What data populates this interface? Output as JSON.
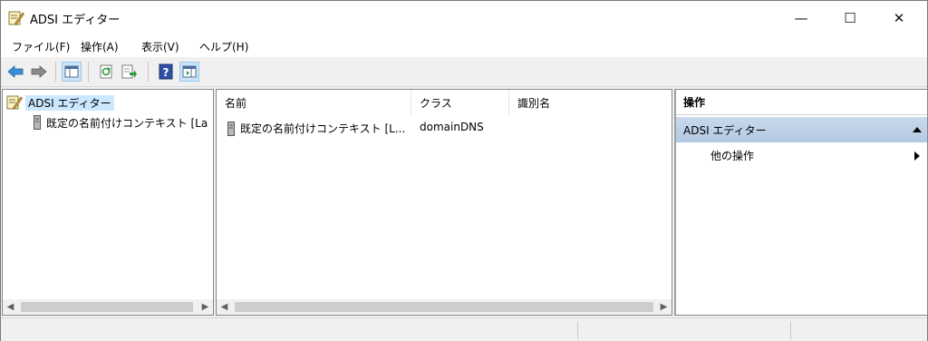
{
  "window": {
    "title": "ADSI エディター",
    "min_glyph": "—",
    "max_glyph": "☐",
    "close_glyph": "✕"
  },
  "menu": [
    {
      "label": "ファイル(F)"
    },
    {
      "label": "操作(A)"
    },
    {
      "label": "表示(V)"
    },
    {
      "label": "ヘルプ(H)"
    }
  ],
  "toolbar": {
    "buttons": [
      "back-icon",
      "forward-icon",
      "show-hide-console-tree-icon",
      "refresh-icon",
      "export-list-icon",
      "help-icon",
      "show-hide-action-pane-icon"
    ]
  },
  "tree": {
    "root_label": "ADSI エディター",
    "child_label": "既定の名前付けコンテキスト [La"
  },
  "list": {
    "columns": [
      "名前",
      "クラス",
      "識別名"
    ],
    "rows": [
      {
        "name": "既定の名前付けコンテキスト [L...",
        "class": "domainDNS",
        "dn": ""
      }
    ]
  },
  "actions": {
    "header": "操作",
    "section": "ADSI エディター",
    "item": "他の操作"
  },
  "colors": {
    "selection": "#cce8ff",
    "section_header": "#b3c9e3",
    "toolbar_pressed": "#cce4f7"
  }
}
